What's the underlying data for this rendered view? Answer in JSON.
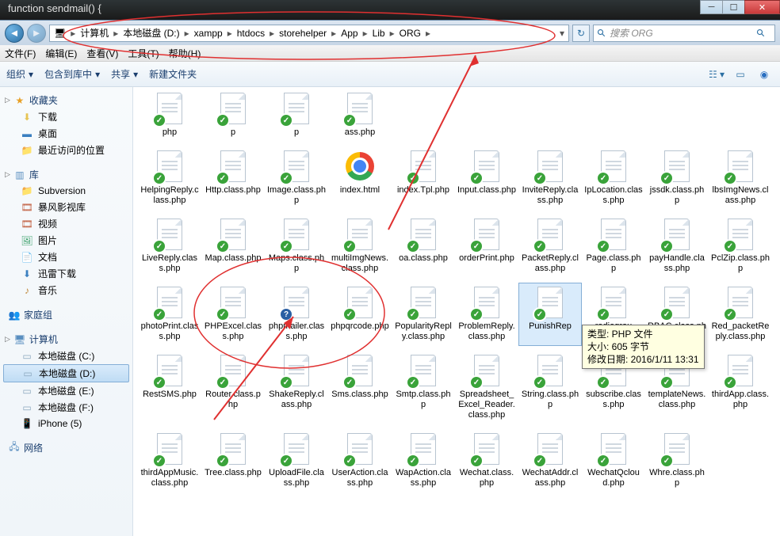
{
  "titlebar": {
    "text": "function  sendmail() {"
  },
  "breadcrumb": {
    "root_icon": "computer-icon",
    "segs": [
      "计算机",
      "本地磁盘 (D:)",
      "xampp",
      "htdocs",
      "storehelper",
      "App",
      "Lib",
      "ORG"
    ]
  },
  "search": {
    "placeholder": "搜索 ORG"
  },
  "menu": {
    "items": [
      "文件(F)",
      "编辑(E)",
      "查看(V)",
      "工具(T)",
      "帮助(H)"
    ]
  },
  "toolbar": {
    "organize": "组织",
    "include": "包含到库中",
    "share": "共享",
    "newfolder": "新建文件夹"
  },
  "sidebar": {
    "fav": {
      "label": "收藏夹",
      "items": [
        "下载",
        "桌面",
        "最近访问的位置"
      ]
    },
    "lib": {
      "label": "库",
      "items": [
        "Subversion",
        "暴风影视库",
        "视频",
        "图片",
        "文档",
        "迅雷下载",
        "音乐"
      ]
    },
    "home": {
      "label": "家庭组"
    },
    "computer": {
      "label": "计算机",
      "items": [
        "本地磁盘 (C:)",
        "本地磁盘 (D:)",
        "本地磁盘 (E:)",
        "本地磁盘 (F:)",
        "iPhone (5)"
      ]
    },
    "network": {
      "label": "网络"
    }
  },
  "files": {
    "row0": [
      {
        "n": "php",
        "b": "chk"
      },
      {
        "n": "p",
        "b": "chk"
      },
      {
        "n": "p",
        "b": "chk"
      },
      {
        "n": "ass.php",
        "b": "chk"
      },
      {
        "n": "",
        "b": "none"
      },
      {
        "n": "",
        "b": "none"
      },
      {
        "n": "",
        "b": "none"
      },
      {
        "n": "",
        "b": "none"
      },
      {
        "n": "",
        "b": "none"
      },
      {
        "n": "",
        "b": "none"
      }
    ],
    "row1": [
      {
        "n": "HelpingReply.class.php",
        "b": "chk"
      },
      {
        "n": "Http.class.php",
        "b": "chk"
      },
      {
        "n": "Image.class.php",
        "b": "chk"
      },
      {
        "n": "index.html",
        "b": "chk",
        "icon": "chrome"
      },
      {
        "n": "index.Tpl.php",
        "b": "chk"
      },
      {
        "n": "Input.class.php",
        "b": "chk"
      },
      {
        "n": "InviteReply.class.php",
        "b": "chk"
      },
      {
        "n": "IpLocation.class.php",
        "b": "chk"
      },
      {
        "n": "jssdk.class.php",
        "b": "chk"
      },
      {
        "n": "lbsImgNews.class.php",
        "b": "chk"
      }
    ],
    "row2": [
      {
        "n": "LiveReply.class.php",
        "b": "chk"
      },
      {
        "n": "Map.class.php",
        "b": "chk"
      },
      {
        "n": "Maps.class.php",
        "b": "chk"
      },
      {
        "n": "multiImgNews.class.php",
        "b": "chk"
      },
      {
        "n": "oa.class.php",
        "b": "chk"
      },
      {
        "n": "orderPrint.php",
        "b": "chk"
      },
      {
        "n": "PacketReply.class.php",
        "b": "chk"
      },
      {
        "n": "Page.class.php",
        "b": "chk"
      },
      {
        "n": "payHandle.class.php",
        "b": "chk"
      },
      {
        "n": "PclZip.class.php",
        "b": "chk"
      }
    ],
    "row3": [
      {
        "n": "photoPrint.class.php",
        "b": "chk"
      },
      {
        "n": "PHPExcel.class.php",
        "b": "chk"
      },
      {
        "n": "phpmailer.class.php",
        "b": "q"
      },
      {
        "n": "phpqrcode.php",
        "b": "chk"
      },
      {
        "n": "PopularityReply.class.php",
        "b": "chk"
      },
      {
        "n": "ProblemReply.class.php",
        "b": "chk"
      },
      {
        "n": "PunishRep",
        "b": "chk",
        "sel": true
      },
      {
        "n": "radiogrou",
        "b": "chk"
      },
      {
        "n": "RBAC.class.php",
        "b": "chk"
      },
      {
        "n": "Red_packetReply.class.php",
        "b": "chk"
      }
    ],
    "row4": [
      {
        "n": "RestSMS.php",
        "b": "chk"
      },
      {
        "n": "Router.class.php",
        "b": "chk"
      },
      {
        "n": "ShakeReply.class.php",
        "b": "chk"
      },
      {
        "n": "Sms.class.php",
        "b": "chk"
      },
      {
        "n": "Smtp.class.php",
        "b": "chk"
      },
      {
        "n": "Spreadsheet_Excel_Reader.class.php",
        "b": "chk"
      },
      {
        "n": "String.class.php",
        "b": "chk"
      },
      {
        "n": "subscribe.class.php",
        "b": "chk"
      },
      {
        "n": "templateNews.class.php",
        "b": "chk"
      },
      {
        "n": "thirdApp.class.php",
        "b": "chk"
      }
    ],
    "row5": [
      {
        "n": "thirdAppMusic.class.php",
        "b": "chk"
      },
      {
        "n": "Tree.class.php",
        "b": "chk"
      },
      {
        "n": "UploadFile.class.php",
        "b": "chk"
      },
      {
        "n": "UserAction.class.php",
        "b": "chk"
      },
      {
        "n": "WapAction.class.php",
        "b": "chk"
      },
      {
        "n": "Wechat.class.php",
        "b": "chk"
      },
      {
        "n": "WechatAddr.class.php",
        "b": "chk"
      },
      {
        "n": "WechatQcloud.php",
        "b": "chk"
      },
      {
        "n": "Whre.class.php",
        "b": "chk"
      },
      {
        "n": "",
        "b": "none"
      }
    ]
  },
  "tooltip": {
    "line1": "类型: PHP 文件",
    "line2": "大小: 605 字节",
    "line3": "修改日期: 2016/1/11 13:31"
  }
}
